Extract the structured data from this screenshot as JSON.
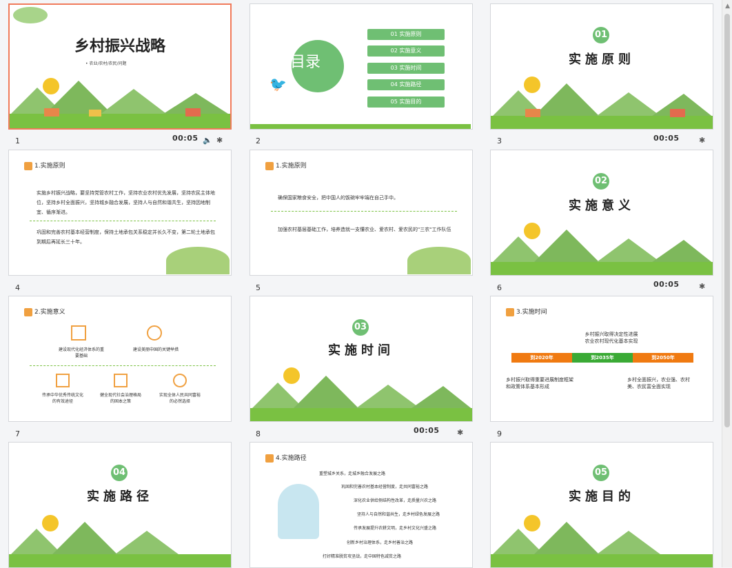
{
  "colors": {
    "green": "#6fbf73",
    "orange": "#f07a11",
    "selected_border": "#f07a5a"
  },
  "slides": [
    {
      "num": "1",
      "title": "乡村振兴战略",
      "subtitle": "• 农业/农村/农民/问题",
      "timing": "00:05"
    },
    {
      "num": "2",
      "toc_title": "目录",
      "items": [
        "01  实施原则",
        "02  实施意义",
        "03  实施时间",
        "04  实施路径",
        "05  实施目的"
      ]
    },
    {
      "num": "3",
      "badge": "01",
      "title": "实施原则",
      "timing": "00:05"
    },
    {
      "num": "4",
      "tag": "1.实施原则",
      "para1": "实施乡村振兴战略，要坚持党管农村工作，坚持农业农村优先发展，坚持农民主体地位，坚持乡村全面振兴，坚持城乡融合发展，坚持人与自然和谐共生，坚持因地制宜、循序渐进。",
      "para2": "巩固和完善农村基本经营制度，保持土地承包关系稳定并长久不变，第二轮土地承包到期后再延长三十年。"
    },
    {
      "num": "5",
      "tag": "1.实施原则",
      "para1": "确保国家粮食安全，把中国人的饭碗牢牢端在自己手中。",
      "para2": "加强农村基层基础工作，培养造就一支懂农业、爱农村、爱农民的\"三农\"工作队伍"
    },
    {
      "num": "6",
      "badge": "02",
      "title": "实施意义",
      "timing": "00:05"
    },
    {
      "num": "7",
      "tag": "2.实施意义",
      "items": [
        "建设现代化经济体系的重要基础",
        "建设美丽中国的关键举措",
        "传承中华优秀传统文化的有效途径",
        "健全现代社会治理格局的固本之策",
        "实现全体人民共同富裕的必然选择"
      ]
    },
    {
      "num": "8",
      "badge": "03",
      "title": "实施时间",
      "timing": "00:05"
    },
    {
      "num": "9",
      "tag": "3.实施时间",
      "top_text": "乡村振兴取得决定性进展\n农业农村现代化基本实现",
      "bars": [
        "到2020年",
        "到2035年",
        "到2050年"
      ],
      "left_text": "乡村振兴取得重要进展制度框架和政策体系基本形成",
      "right_text": "乡村全面振兴，农业强、农村美、农民富全面实现"
    },
    {
      "num": "10",
      "badge": "04",
      "title": "实施路径"
    },
    {
      "num": "11",
      "tag": "4.实施路径",
      "steps": [
        "重塑城乡关系，走城乡融合发展之路",
        "巩固和完善农村基本经营制度，走共同富裕之路",
        "深化农业供给侧结构性改革，走质量兴农之路",
        "坚持人与自然和谐共生，走乡村绿色发展之路",
        "传承发展提升农耕文明，走乡村文化兴盛之路",
        "创新乡村治理体系，走乡村善治之路",
        "打好精准脱贫攻坚战，走中国特色减贫之路"
      ]
    },
    {
      "num": "12",
      "badge": "05",
      "title": "实施目的"
    }
  ]
}
